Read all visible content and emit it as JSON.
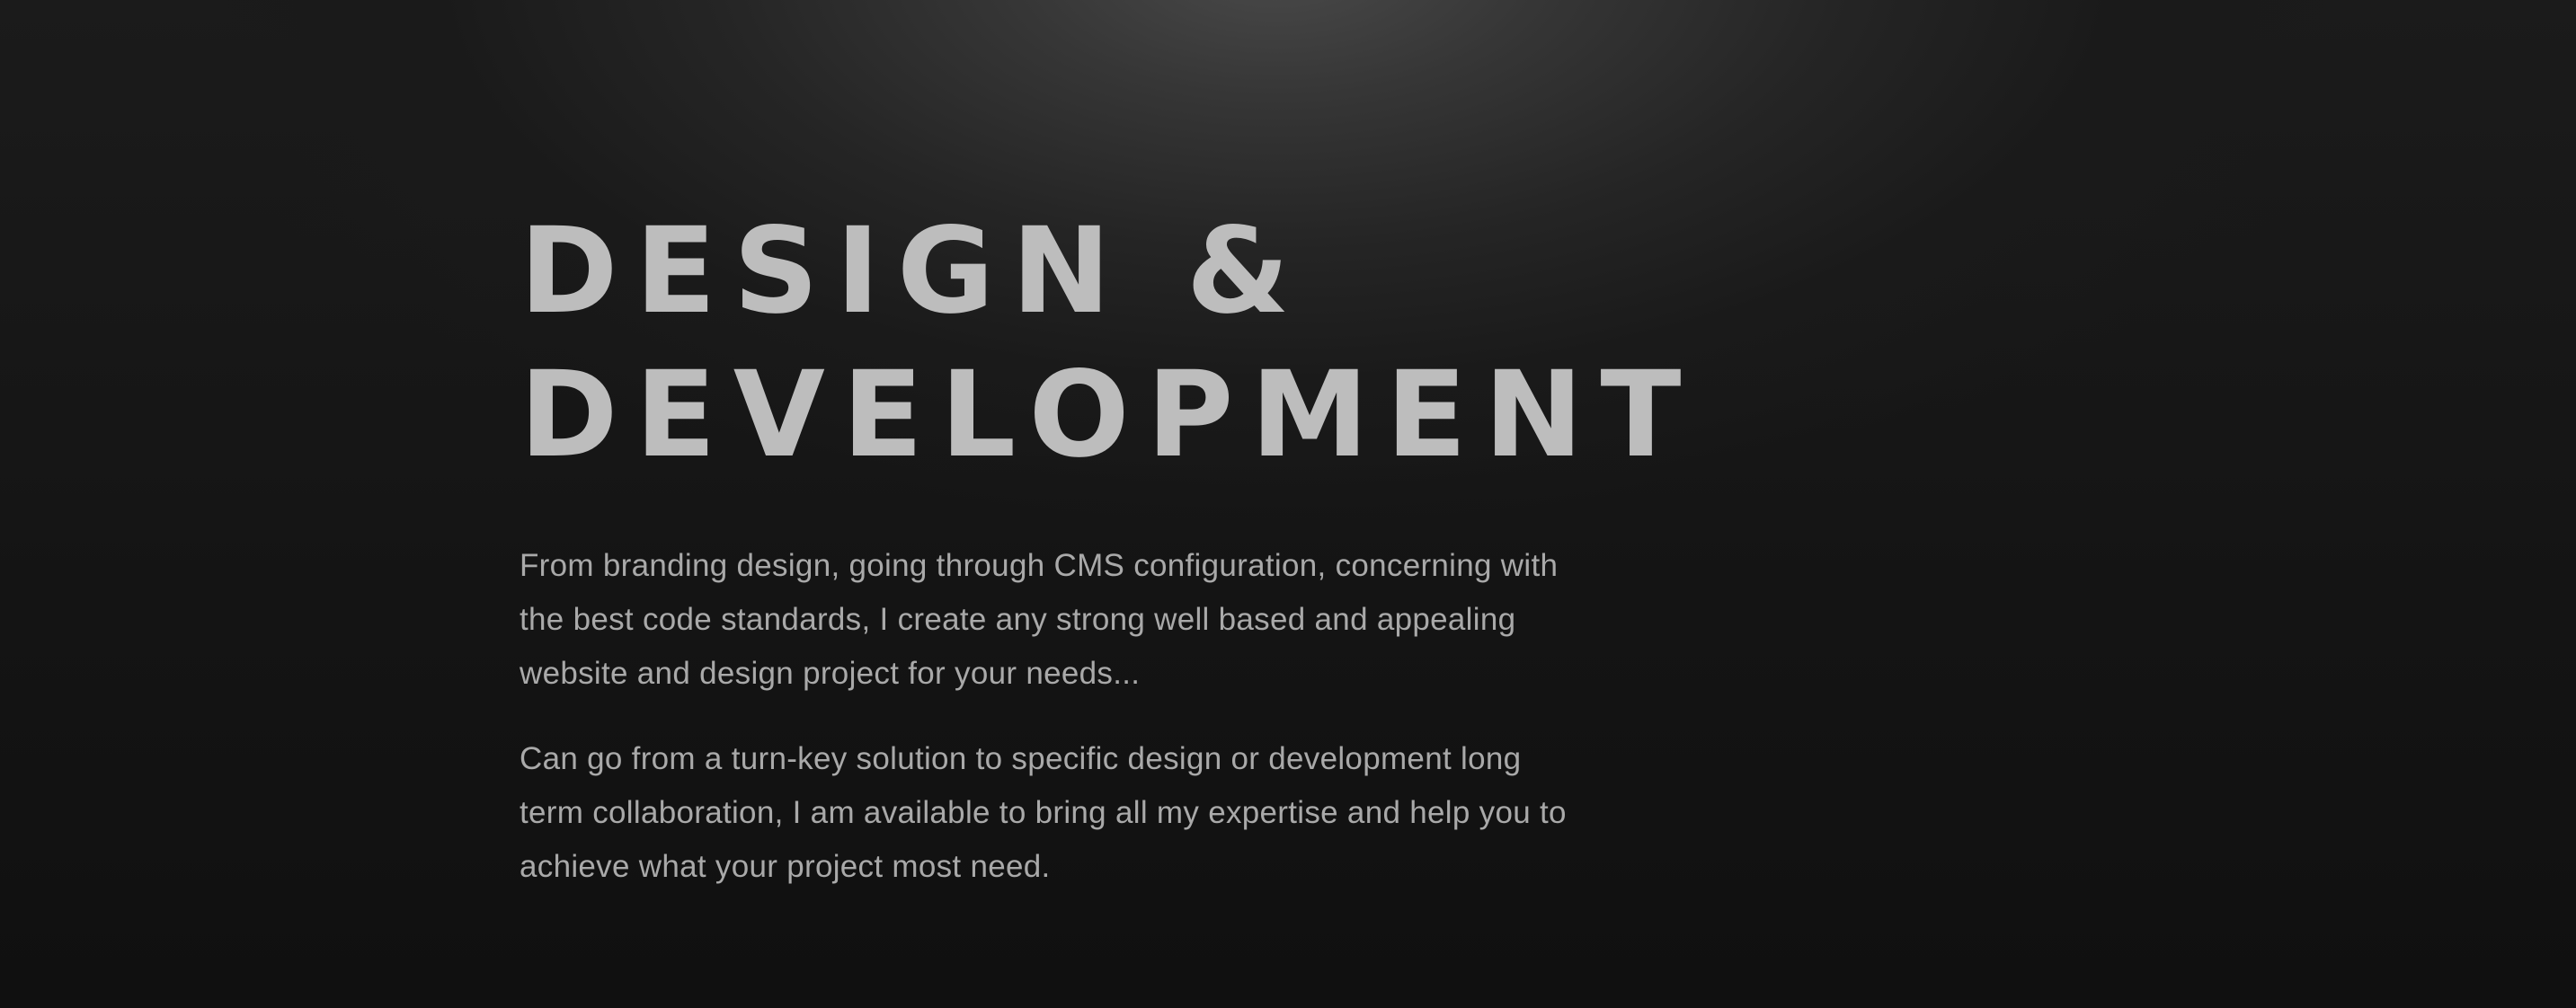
{
  "hero": {
    "headline_line1": "DESIGN &",
    "headline_line2": "DEVELOPMENT",
    "paragraphs": [
      "From branding design, going through CMS configuration, concerning with the best code standards, I create any strong well based and appealing website and design project for your needs...",
      "Can go from a turn-key solution to specific design or development long term collaboration, I am available to bring all my expertise and help you to achieve what your project most need."
    ],
    "colors": {
      "background_dark": "#121212",
      "glow": "#4a4a4a",
      "headline": "#bdbdbd",
      "body_text": "#a9a9a9"
    }
  }
}
